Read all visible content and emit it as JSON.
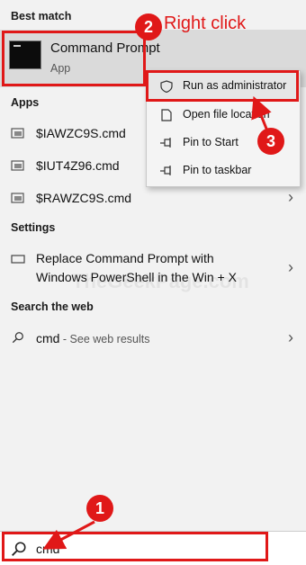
{
  "best_match": {
    "section_title": "Best match",
    "app_name": "Command Prompt",
    "app_type": "App"
  },
  "apps": {
    "section_title": "Apps",
    "items": [
      {
        "label": "$IAWZC9S.cmd"
      },
      {
        "label": "$IUT4Z96.cmd"
      },
      {
        "label": "$RAWZC9S.cmd"
      }
    ]
  },
  "settings": {
    "section_title": "Settings",
    "item_line1": "Replace Command Prompt with",
    "item_line2": "Windows PowerShell in the Win + X"
  },
  "web": {
    "section_title": "Search the web",
    "query": "cmd",
    "suffix": " - See web results"
  },
  "context_menu": {
    "items": [
      {
        "label": "Run as administrator",
        "icon": "shield-icon"
      },
      {
        "label": "Open file location",
        "icon": "file-location-icon"
      },
      {
        "label": "Pin to Start",
        "icon": "pin-icon"
      },
      {
        "label": "Pin to taskbar",
        "icon": "pin-icon"
      }
    ]
  },
  "annotations": {
    "step1": "1",
    "step2": "2",
    "step3": "3",
    "right_click_label": "Right click",
    "color": "#e01818"
  },
  "search_bar": {
    "value": "cmd",
    "icon": "search-icon"
  },
  "watermark": "TheGeekPage.com"
}
